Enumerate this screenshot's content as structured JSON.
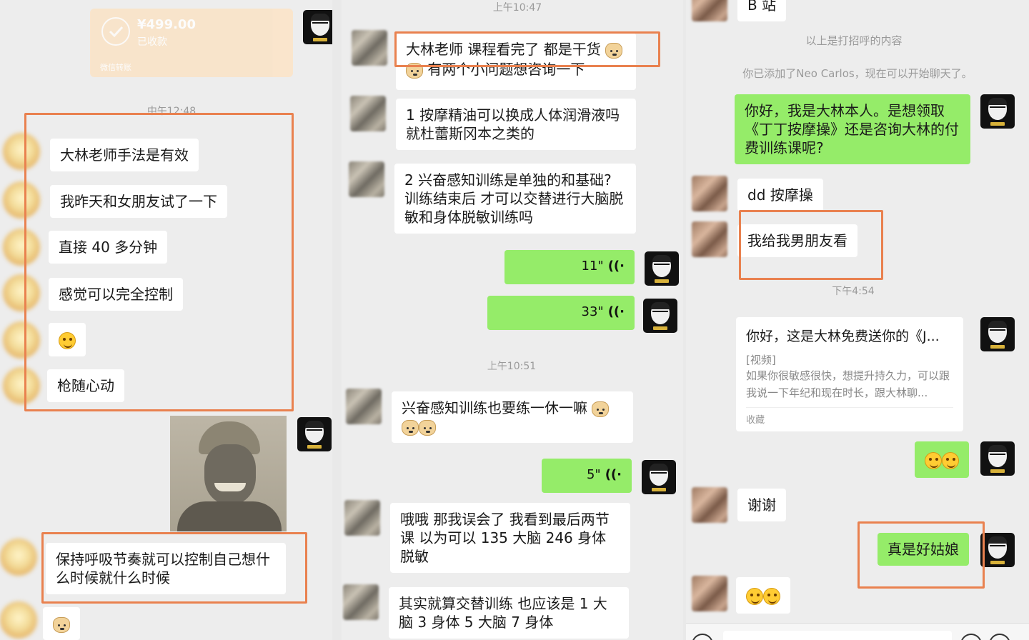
{
  "panel1": {
    "payment": {
      "amount": "¥499.00",
      "status": "已收款",
      "footer": "微信转账"
    },
    "time": "中午12:48",
    "messages": [
      "大林老师手法是有效",
      "我昨天和女朋友试了一下",
      "直接 40 多分钟",
      "感觉可以完全控制",
      "枪随心动",
      "保持呼吸节奏就可以控制自己想什么时候就什么时候"
    ],
    "emoji_names": [
      "laugh-emoji",
      "doge-emoji"
    ]
  },
  "panel2": {
    "time_top": "上午10:47",
    "time_mid": "上午10:51",
    "messages": [
      "大林老师 课程看完了 都是干货",
      "有两个小问题想咨询一下",
      "1 按摩精油可以换成人体润滑液吗就杜蕾斯冈本之类的",
      "2 兴奋感知训练是单独的和基础? 训练结束后 才可以交替进行大脑脱敏和身体脱敏训练吗",
      "兴奋感知训练也要练一休一嘛",
      "哦哦 那我误会了 我看到最后两节课 以为可以 135 大脑 246 身体脱敏",
      "其实就算交替训练 也应该是 1 大脑 3 身体 5 大脑 7 身体"
    ],
    "voices": [
      "11\"",
      "33\"",
      "5\""
    ]
  },
  "panel3": {
    "top_fragment": "B 站",
    "sys1": "以上是打招呼的内容",
    "sys2": "你已添加了Neo Carlos，现在可以开始聊天了。",
    "greeting": "你好，我是大林本人。是想领取《丁丁按摩操》还是咨询大林的付费训练课呢?",
    "reply1": "dd 按摩操",
    "reply2": "我给我男朋友看",
    "time": "下午4:54",
    "card": {
      "title": "你好，这是大林免费送你的《J...",
      "tag": "[视频]",
      "desc": "如果你很敏感很快，想提升持久力，可以跟我说一下年纪和现在时长，跟大林聊...",
      "footer": "收藏"
    },
    "thanks": "谢谢",
    "good_girl": "真是好姑娘"
  },
  "colors": {
    "highlight_box": "#e9814f",
    "self_bubble": "#95ec69",
    "background": "#ededed"
  }
}
